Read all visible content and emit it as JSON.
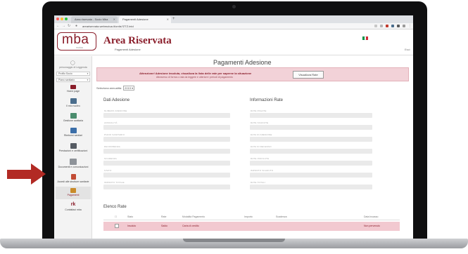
{
  "browser": {
    "tabs": [
      {
        "title": "Area riservata - Socio Mba"
      },
      {
        "title": "Pagamenti Adesione"
      }
    ],
    "url": "areariservata.webmutua.it/ontis?ZTZ.intd",
    "colors": {
      "close": "#ff5f57",
      "minimize": "#febc2e",
      "maximize": "#28c840"
    }
  },
  "header": {
    "logo_text": "mba",
    "logo_subtext": "mutua",
    "title": "Area Riservata",
    "subtitle": "Pagamenti Adesione",
    "flag_colors": [
      "#009246",
      "#ffffff",
      "#ce2b37"
    ],
    "exit_label": "Esci"
  },
  "sidebar": {
    "user_label": "personaggio di Leggenda",
    "selects": [
      "Profilo Socio",
      "Piano sanitario"
    ],
    "items": [
      {
        "label": "Home page",
        "icon": "home-icon",
        "color": "#8a1d2a"
      },
      {
        "label": "Il mio nucleo",
        "icon": "family-icon",
        "color": "#4a6d8c"
      },
      {
        "label": "Gestione sanitaria",
        "icon": "health-icon",
        "color": "#4a8c6d"
      },
      {
        "label": "Rimborsi sanitari",
        "icon": "refund-icon",
        "color": "#3b6ea8"
      },
      {
        "label": "Prestazioni e certificazioni",
        "icon": "certificate-icon",
        "color": "#555b63"
      },
      {
        "label": "Documenti e comunicazioni",
        "icon": "documents-icon",
        "color": "#8e9399"
      },
      {
        "label": "Accedi alle strutture sanitarie",
        "icon": "hospital-icon",
        "color": "#c24c35"
      },
      {
        "label": "Pagamenti",
        "icon": "payments-icon",
        "color": "#c98b2a",
        "selected": true
      },
      {
        "label": "Contattaci mba",
        "icon": "contact-icon",
        "color": "#8a1d2a"
      }
    ]
  },
  "page": {
    "title": "Pagamenti Adesione",
    "alert": {
      "line1": "Attenzione! Adesione insoluta, visualizza la lista delle rate per saperne la situazione",
      "line2": "Attraverso di forma o rata da leggere e ulteriore i periodi di pagamento",
      "button_label": "Visualizza Rate"
    },
    "annuality_label": "Seleziona annualità:",
    "annuality_value": "2019",
    "membership": {
      "title": "Dati Adesione",
      "fields": [
        "NUMERO ADESIONE",
        "ANNUALITÀ",
        "PIANO SANITARIO",
        "DECORRENZA",
        "SCADENZA",
        "STATO",
        "IMPORTO TOTALE"
      ]
    },
    "installments_info": {
      "title": "Informazioni Rate",
      "fields": [
        "RATE PAGATE",
        "RATE SCADUTE",
        "DATA DI ADESIONE",
        "DATA DI RECESSO",
        "RATE INSOLUTE",
        "IMPORTO SCADUTO",
        "RATE TOTALI"
      ]
    },
    "installments": {
      "title": "Elenco Rate",
      "columns": [
        "Stato",
        "Rate",
        "Modalità Pagamento",
        "Importo",
        "Scadenza",
        "Data Incasso"
      ],
      "rows": [
        {
          "status": "Insoluto",
          "rate": "Saldo",
          "method": "Carta di credito",
          "amount": "",
          "due": "",
          "collected": "Non pervenuto"
        }
      ]
    }
  },
  "annotation": {
    "arrow_color": "#b22a24"
  }
}
